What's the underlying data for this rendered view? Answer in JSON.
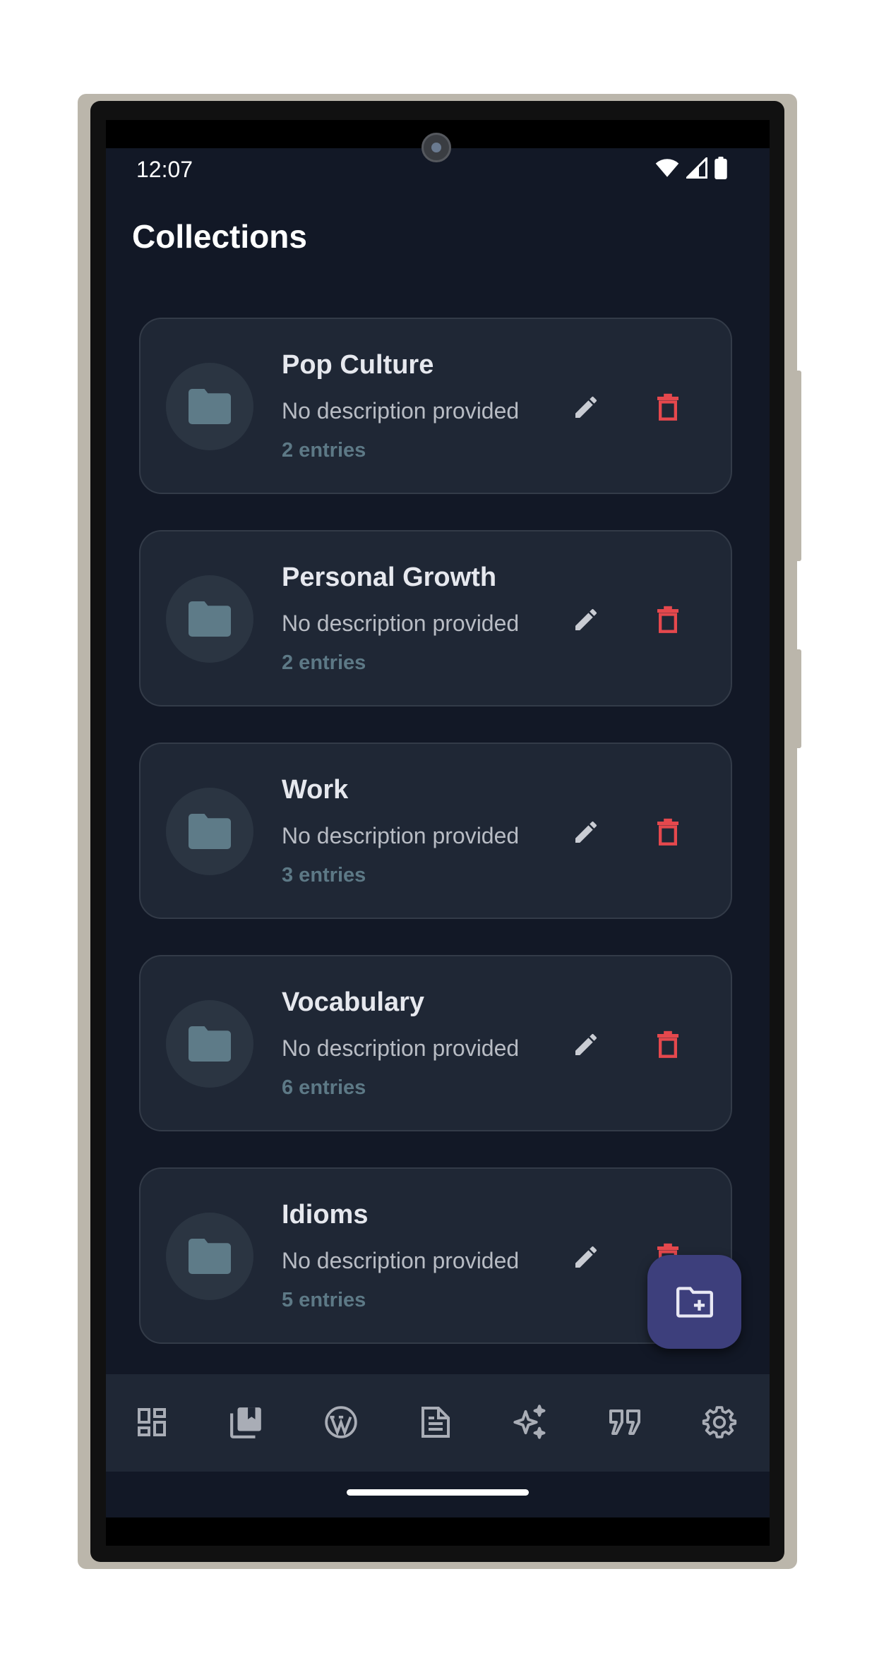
{
  "status_bar": {
    "time": "12:07"
  },
  "page": {
    "title": "Collections"
  },
  "collections": [
    {
      "name": "Pop Culture",
      "description": "No description provided",
      "count": "2 entries"
    },
    {
      "name": "Personal Growth",
      "description": "No description provided",
      "count": "2 entries"
    },
    {
      "name": "Work",
      "description": "No description provided",
      "count": "3 entries"
    },
    {
      "name": "Vocabulary",
      "description": "No description provided",
      "count": "6 entries"
    },
    {
      "name": "Idioms",
      "description": "No description provided",
      "count": "5 entries"
    }
  ],
  "fab": {
    "icon": "create-new-folder-icon"
  },
  "nav": {
    "items": [
      {
        "icon": "dashboard-icon"
      },
      {
        "icon": "collections-bookmark-icon",
        "active": true
      },
      {
        "icon": "wordpress-icon"
      },
      {
        "icon": "article-icon"
      },
      {
        "icon": "sparkles-icon"
      },
      {
        "icon": "quote-icon"
      },
      {
        "icon": "settings-gear-icon"
      }
    ]
  },
  "colors": {
    "background": "#121826",
    "card": "#1f2735",
    "folder_icon": "#5e7b88",
    "delete": "#e5484d",
    "fab": "#3d3f7c",
    "nav_icon": "#a9adb6"
  }
}
